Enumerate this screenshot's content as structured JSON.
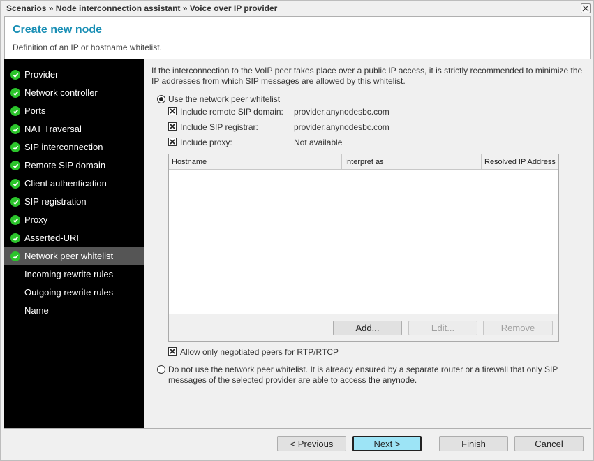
{
  "window": {
    "breadcrumb": "Scenarios » Node interconnection assistant » Voice over IP provider",
    "close_icon": "close-icon"
  },
  "header": {
    "title": "Create new node",
    "subtitle": "Definition of an IP or hostname whitelist."
  },
  "sidebar": {
    "items": [
      {
        "label": "Provider",
        "completed": true,
        "active": false
      },
      {
        "label": "Network controller",
        "completed": true,
        "active": false
      },
      {
        "label": "Ports",
        "completed": true,
        "active": false
      },
      {
        "label": "NAT Traversal",
        "completed": true,
        "active": false
      },
      {
        "label": "SIP interconnection",
        "completed": true,
        "active": false
      },
      {
        "label": "Remote SIP domain",
        "completed": true,
        "active": false
      },
      {
        "label": "Client authentication",
        "completed": true,
        "active": false
      },
      {
        "label": "SIP registration",
        "completed": true,
        "active": false
      },
      {
        "label": "Proxy",
        "completed": true,
        "active": false
      },
      {
        "label": "Asserted-URI",
        "completed": true,
        "active": false
      },
      {
        "label": "Network peer whitelist",
        "completed": true,
        "active": true
      },
      {
        "label": "Incoming rewrite rules",
        "completed": false,
        "active": false
      },
      {
        "label": "Outgoing rewrite rules",
        "completed": false,
        "active": false
      },
      {
        "label": "Name",
        "completed": false,
        "active": false
      }
    ]
  },
  "main": {
    "intro": "If the interconnection to the VoIP peer takes place over a public IP access, it is strictly recommended to minimize the IP addresses from which SIP messages are allowed by this whitelist.",
    "use_whitelist": {
      "label": "Use the network peer whitelist",
      "selected": true
    },
    "includes": [
      {
        "label": "Include remote SIP domain:",
        "checked": true,
        "value": "provider.anynodesbc.com"
      },
      {
        "label": "Include SIP registrar:",
        "checked": true,
        "value": "provider.anynodesbc.com"
      },
      {
        "label": "Include proxy:",
        "checked": true,
        "value": "Not available"
      }
    ],
    "table": {
      "columns": [
        "Hostname",
        "Interpret as",
        "Resolved IP Address"
      ],
      "rows": []
    },
    "table_buttons": {
      "add": "Add...",
      "edit": "Edit...",
      "remove": "Remove"
    },
    "allow_negotiated": {
      "label": "Allow only negotiated peers for RTP/RTCP",
      "checked": true
    },
    "no_whitelist": {
      "label": "Do not use the network peer whitelist. It is already ensured by a separate router or a firewall that only SIP messages of the selected provider are able to access the anynode.",
      "selected": false
    }
  },
  "footer": {
    "previous": "< Previous",
    "next": "Next >",
    "finish": "Finish",
    "cancel": "Cancel"
  }
}
